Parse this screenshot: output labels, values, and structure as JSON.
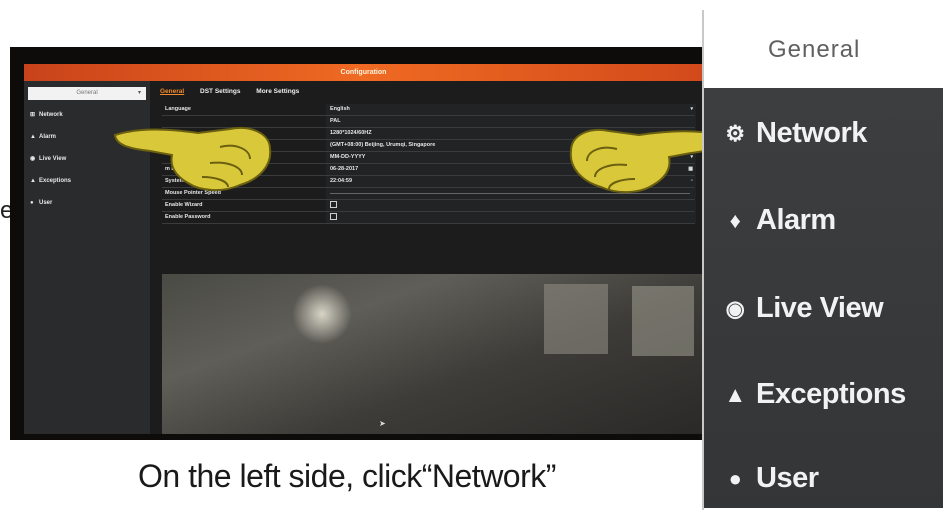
{
  "window": {
    "title": "Configuration"
  },
  "sidebar": {
    "section_selector": "General",
    "items": [
      {
        "label": "Network",
        "icon": "network-icon"
      },
      {
        "label": "Alarm",
        "icon": "bell-icon"
      },
      {
        "label": "Live View",
        "icon": "eye-icon"
      },
      {
        "label": "Exceptions",
        "icon": "warning-icon"
      },
      {
        "label": "User",
        "icon": "user-icon"
      }
    ]
  },
  "tabs": [
    "General",
    "DST Settings",
    "More Settings"
  ],
  "form": {
    "rows": [
      {
        "label": "Language",
        "value": "English"
      },
      {
        "label": "",
        "value": "PAL"
      },
      {
        "label": "",
        "value": "1280*1024/60HZ"
      },
      {
        "label": "",
        "value": "(GMT+08:00) Beijing, Urumqi, Singapore"
      },
      {
        "label": "",
        "value": "MM-DD-YYYY"
      },
      {
        "label": "m Date",
        "value": "06-28-2017"
      },
      {
        "label": "System Time",
        "value": "22:04:59"
      },
      {
        "label": "Mouse Pointer Speed",
        "value": ""
      },
      {
        "label": "Enable Wizard",
        "value": ""
      },
      {
        "label": "Enable Password",
        "value": ""
      }
    ]
  },
  "caption": "On the left side, click“Network”",
  "cut_char": "e",
  "zoom": {
    "header": "General",
    "items": [
      {
        "label": "Network",
        "icon": "network-icon"
      },
      {
        "label": "Alarm",
        "icon": "bell-icon"
      },
      {
        "label": "Live View",
        "icon": "eye-icon"
      },
      {
        "label": "Exceptions",
        "icon": "warning-icon"
      },
      {
        "label": "User",
        "icon": "user-icon"
      }
    ]
  },
  "colors": {
    "titlebar": "#e85d20",
    "active_tab": "#f38b2a",
    "hand": "#d9c93a"
  }
}
